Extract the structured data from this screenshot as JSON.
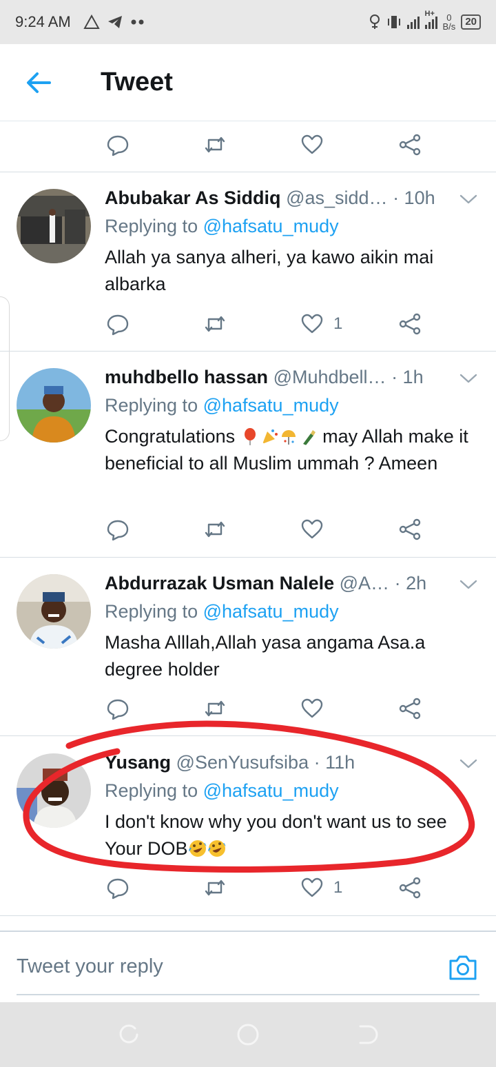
{
  "status_bar": {
    "time": "9:24 AM",
    "net_speed_value": "0",
    "net_speed_unit": "B/s",
    "network_type": "H+",
    "battery": "20",
    "icons": [
      "warning-icon",
      "telegram-icon",
      "dots-icon",
      "alarm-icon",
      "vibrate-icon",
      "signal-icon",
      "battery-icon"
    ]
  },
  "header": {
    "title": "Tweet",
    "back_icon": "back-arrow-icon"
  },
  "colors": {
    "accent": "#1da1f2",
    "muted": "#657786",
    "text": "#14171a",
    "annotation": "#e8262b"
  },
  "tweets": [
    {
      "name": "Abubakar As Siddiq",
      "handle": "@as_sidd…",
      "time": "· 10h",
      "replying_prefix": "Replying to ",
      "mention": "@hafsatu_mudy",
      "text": "Allah ya sanya alheri, ya kawo aikin mai albarka",
      "like_count": "1"
    },
    {
      "name": "muhdbello hassan",
      "handle": "@Muhdbell…",
      "time": " · 1h",
      "replying_prefix": "Replying to ",
      "mention": "@hafsatu_mudy",
      "text_before": "Congratulations ",
      "text_after": " may Allah make it beneficial to all Muslim ummah ? Ameen",
      "emojis": [
        "balloon-emoji",
        "party-popper-emoji",
        "confetti-emoji",
        "champagne-emoji"
      ],
      "like_count": ""
    },
    {
      "name": "Abdurrazak Usman Nalele",
      "handle": "@A…",
      "time": " · 2h",
      "replying_prefix": "Replying to ",
      "mention": "@hafsatu_mudy",
      "text": "Masha Alllah,Allah yasa angama Asa.a degree holder",
      "like_count": ""
    },
    {
      "name": "Yusang",
      "handle": "@SenYusufsiba",
      "time": "· 11h",
      "replying_prefix": "Replying to ",
      "mention": "@hafsatu_mudy",
      "text": "I don't know why you don't want us to see Your DOB",
      "emojis": [
        "rofl-emoji",
        "rofl-emoji"
      ],
      "like_count": "1"
    }
  ],
  "reply_bar": {
    "placeholder": "Tweet your reply",
    "camera_icon": "camera-icon"
  },
  "nav_bar": {
    "icons": [
      "recents-icon",
      "home-icon",
      "back-icon"
    ]
  }
}
